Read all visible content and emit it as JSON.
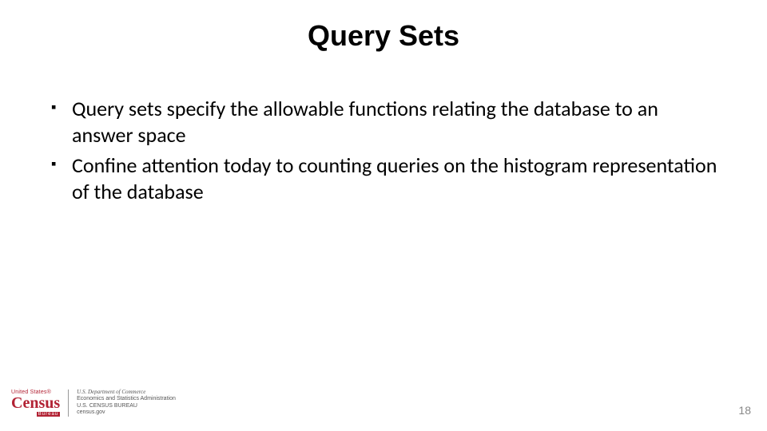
{
  "title": "Query Sets",
  "bullets": [
    "Query sets specify the allowable functions relating the database to an answer space",
    "Confine attention today to counting queries on the histogram representation of the database"
  ],
  "footer": {
    "logo_top": "United States®",
    "logo_main": "Census",
    "logo_sub": "Bureau",
    "dept_line1": "U.S. Department of Commerce",
    "dept_line2": "Economics and Statistics Administration",
    "dept_line3": "U.S. CENSUS BUREAU",
    "dept_line4": "census.gov"
  },
  "page_number": "18"
}
